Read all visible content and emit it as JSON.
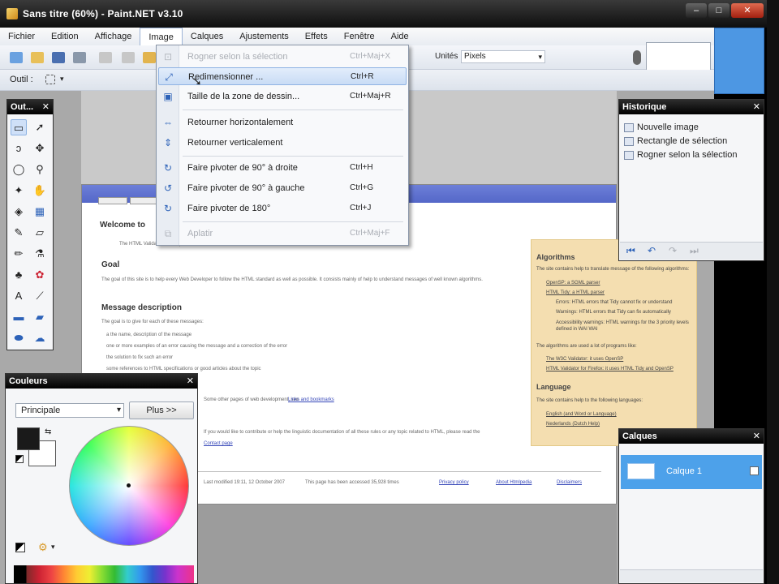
{
  "window": {
    "title": "Sans titre (60%) - Paint.NET v3.10"
  },
  "menubar": {
    "items": [
      "Fichier",
      "Edition",
      "Affichage",
      "Image",
      "Calques",
      "Ajustements",
      "Effets",
      "Fenêtre",
      "Aide"
    ],
    "active": "Image"
  },
  "toolbar": {
    "units_label": "Unités :",
    "units_value": "Pixels",
    "tool_label": "Outil :"
  },
  "image_menu": {
    "items": [
      {
        "label": "Rogner selon la sélection",
        "shortcut": "Ctrl+Maj+X",
        "icon": "crop-icon",
        "disabled": true
      },
      {
        "label": "Redimensionner ...",
        "shortcut": "Ctrl+R",
        "icon": "resize-icon",
        "highlighted": true
      },
      {
        "label": "Taille de la zone de dessin...",
        "shortcut": "Ctrl+Maj+R",
        "icon": "canvas-size-icon"
      },
      {
        "label": "Retourner horizontalement",
        "shortcut": "",
        "icon": "flip-horizontal-icon"
      },
      {
        "label": "Retourner verticalement",
        "shortcut": "",
        "icon": "flip-vertical-icon"
      },
      {
        "label": "Faire pivoter de 90° à droite",
        "shortcut": "Ctrl+H",
        "icon": "rotate-right-icon"
      },
      {
        "label": "Faire pivoter de 90° à gauche",
        "shortcut": "Ctrl+G",
        "icon": "rotate-left-icon"
      },
      {
        "label": "Faire pivoter de 180°",
        "shortcut": "Ctrl+J",
        "icon": "rotate-180-icon"
      },
      {
        "label": "Aplatir",
        "shortcut": "Ctrl+Maj+F",
        "icon": "flatten-icon",
        "disabled": true
      }
    ]
  },
  "tools_panel": {
    "title": "Out..."
  },
  "history_panel": {
    "title": "Historique",
    "items": [
      "Nouvelle image",
      "Rectangle de sélection",
      "Rogner selon la sélection"
    ]
  },
  "layers_panel": {
    "title": "Calques",
    "layer_name": "Calque 1"
  },
  "colors_panel": {
    "title": "Couleurs",
    "mode": "Principale",
    "more_button": "Plus >>"
  },
  "webpage": {
    "welcome": "Welcome to",
    "intro": "The HTML Validator is an Open Source tool",
    "goal_heading": "Goal",
    "goal_text": "The goal of this site is to help every Web Developer to follow the HTML standard as well as possible. It consists mainly of help to understand messages of well known algorithms.",
    "msg_heading": "Message description",
    "msg_text": "The goal is to give for each of these messages:",
    "bullets": [
      "a the name, description of the message",
      "one or more examples of an error causing the message and a correction of the error",
      "the solution to fix such an error",
      "some references to HTML specifications or good articles about the topic"
    ],
    "dev_text": "Some other pages of web development, see",
    "dev_link": "Links and bookmarks",
    "contrib_text": "If you would like to contribute or help the linguistic documentation of all these rules or any topic related to HTML, please read the",
    "contrib_link": "Contact page",
    "footer": [
      "Last modified 19:11, 12 October 2007",
      "This page has been accessed 35,928 times",
      "Privacy policy",
      "About Htmlpedia",
      "Disclaimers"
    ],
    "sidebar": {
      "algo_heading": "Algorithms",
      "algo_text": "The site contains help to translate message of the following algorithms:",
      "algo_items": [
        "OpenSP: a SGML parser",
        "HTML Tidy: a HTML parser",
        "Errors: HTML errors that Tidy cannot fix or understand",
        "Warnings: HTML errors that Tidy can fix automatically",
        "Accessibility warnings: HTML warnings for the 3 priority levels defined in WAI WAI"
      ],
      "algo_note": "The algorithms are used a lot of programs like:",
      "prog_items": [
        "The W3C Validator: it uses OpenSP",
        "HTML Validator for Firefox: it uses HTML Tidy and OpenSP"
      ],
      "lang_heading": "Language",
      "lang_text": "The site contains help to the following languages:",
      "lang_items": [
        "English (and Word or Language)",
        "Nederlands (Dutch Help)"
      ]
    }
  }
}
